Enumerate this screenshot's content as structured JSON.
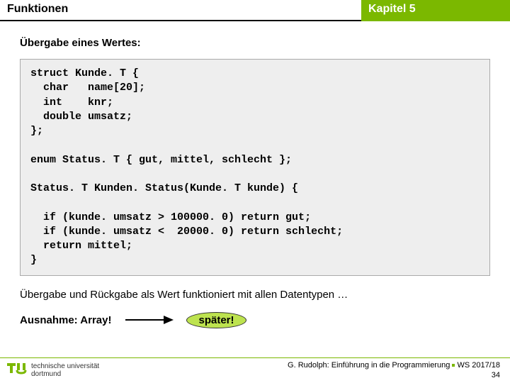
{
  "header": {
    "left": "Funktionen",
    "right": "Kapitel 5"
  },
  "subtitle": "Übergabe eines Wertes:",
  "code": "struct Kunde. T {\n  char   name[20];\n  int    knr;\n  double umsatz;\n};\n\nenum Status. T { gut, mittel, schlecht };\n\nStatus. T Kunden. Status(Kunde. T kunde) {\n\n  if (kunde. umsatz > 100000. 0) return gut;\n  if (kunde. umsatz <  20000. 0) return schlecht;\n  return mittel;\n}",
  "note": "Übergabe und Rückgabe als Wert funktioniert mit allen Datentypen …",
  "exception_label": "Ausnahme: Array!",
  "later_label": "später!",
  "footer": {
    "uni_line1": "technische universität",
    "uni_line2": "dortmund",
    "credit": "G. Rudolph: Einführung in die Programmierung",
    "term": "WS 2017/18",
    "page": "34"
  }
}
